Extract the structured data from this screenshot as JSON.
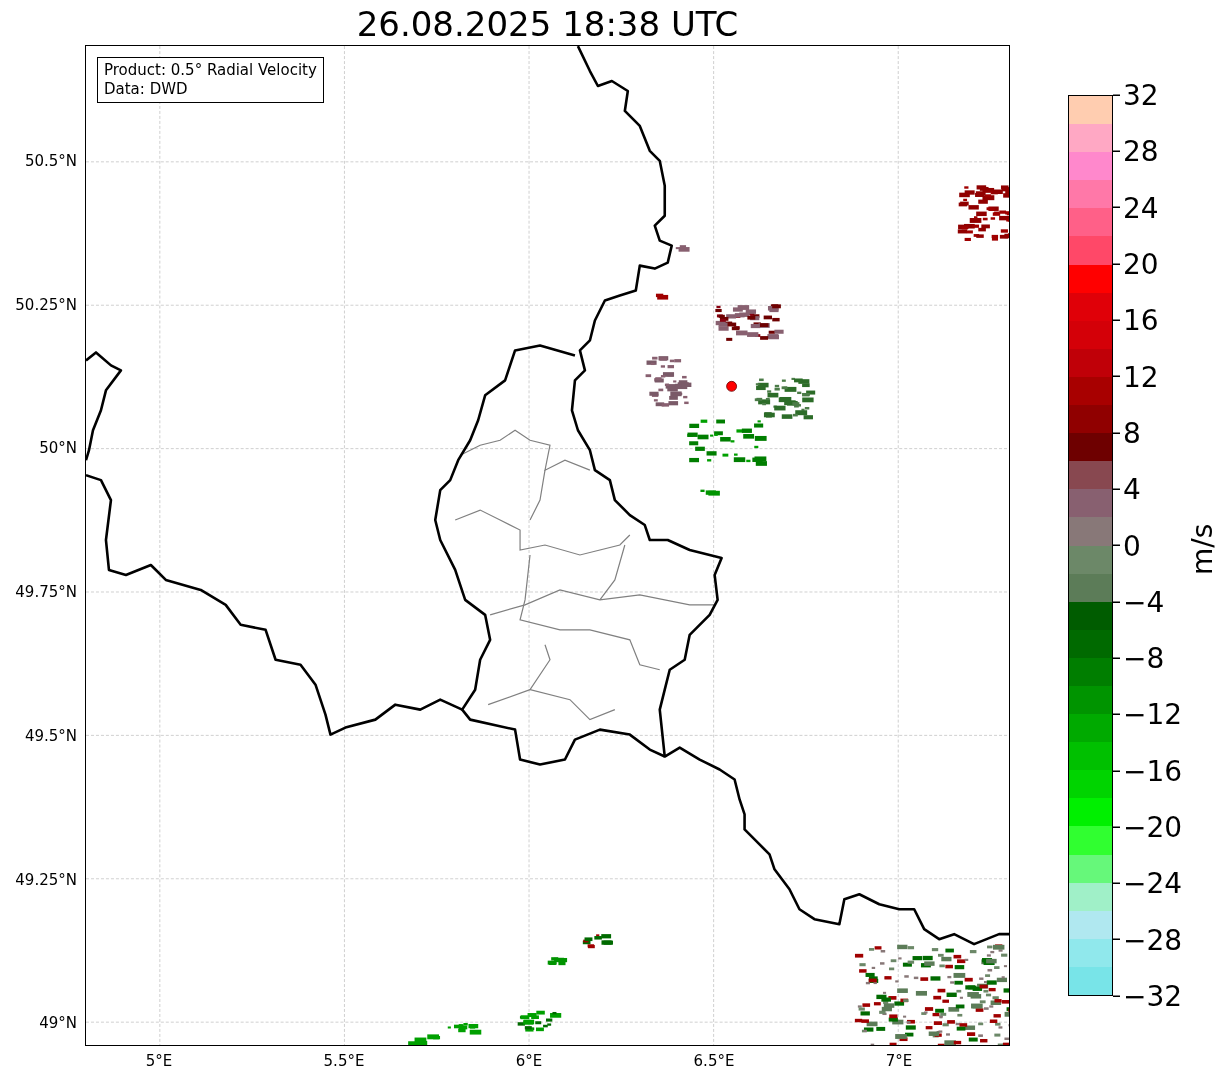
{
  "title": "26.08.2025 18:38 UTC",
  "info_box": [
    "Product: 0.5° Radial Velocity",
    "Data: DWD"
  ],
  "lat_labels": [
    "50.5°N",
    "50.25°N",
    "50°N",
    "49.75°N",
    "49.5°N",
    "49.25°N",
    "49°N"
  ],
  "lon_labels": [
    "5°E",
    "5.5°E",
    "6°E",
    "6.5°E",
    "7°E"
  ],
  "colorbar": {
    "unit": "m/s",
    "ticks": [
      "32",
      "28",
      "24",
      "20",
      "16",
      "12",
      "8",
      "4",
      "0",
      "−4",
      "−8",
      "−12",
      "−16",
      "−20",
      "−24",
      "−28",
      "−32"
    ],
    "segments": [
      {
        "color": "#ffcdb0"
      },
      {
        "color": "#ffa8c4"
      },
      {
        "color": "#ff88cc"
      },
      {
        "color": "#ff78a8"
      },
      {
        "color": "#ff6088"
      },
      {
        "color": "#ff4868"
      },
      {
        "color": "#ff0000"
      },
      {
        "color": "#e00008"
      },
      {
        "color": "#d40008"
      },
      {
        "color": "#c00008"
      },
      {
        "color": "#a80000"
      },
      {
        "color": "#900000"
      },
      {
        "color": "#6e0000"
      },
      {
        "color": "#884850"
      },
      {
        "color": "#886070"
      },
      {
        "color": "#887878"
      },
      {
        "color": "#6c8868"
      },
      {
        "color": "#5c7c58"
      },
      {
        "color": "#005c00"
      },
      {
        "color": "#006a00"
      },
      {
        "color": "#007e00"
      },
      {
        "color": "#009400"
      },
      {
        "color": "#00aa00"
      },
      {
        "color": "#00c000"
      },
      {
        "color": "#00d400"
      },
      {
        "color": "#00f000"
      },
      {
        "color": "#30ff30"
      },
      {
        "color": "#66f87a"
      },
      {
        "color": "#a0f0c8"
      },
      {
        "color": "#b0e8f0"
      },
      {
        "color": "#90e8ec"
      },
      {
        "color": "#78e4e8"
      }
    ]
  }
}
